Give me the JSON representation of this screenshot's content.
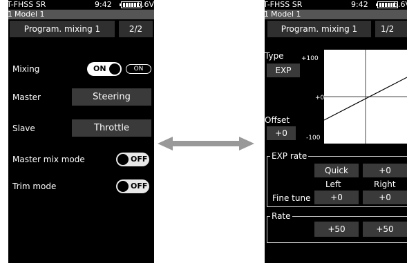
{
  "left": {
    "status": {
      "system": "T-FHSS SR",
      "time": "9:42",
      "voltage": "6.6V"
    },
    "model": {
      "number": "1",
      "name": "Model 1"
    },
    "title": "Program. mixing 1",
    "page": "2/2",
    "mixing": {
      "label": "Mixing",
      "switch_value": "ON",
      "status_value": "ON"
    },
    "master": {
      "label": "Master",
      "value": "Steering"
    },
    "slave": {
      "label": "Slave",
      "value": "Throttle"
    },
    "master_mix_mode": {
      "label": "Master mix mode",
      "value": "OFF"
    },
    "trim_mode": {
      "label": "Trim mode",
      "value": "OFF"
    }
  },
  "right": {
    "status": {
      "system": "T-FHSS SR",
      "time": "9:42",
      "voltage": "6.6V"
    },
    "model": {
      "number": "1",
      "name": "Model 1"
    },
    "title": "Program. mixing 1",
    "page": "1/2",
    "type": {
      "label": "Type",
      "value": "EXP"
    },
    "graph": {
      "top_label": "+100",
      "mid_label": "+0",
      "bottom_label": "-100"
    },
    "offset": {
      "label": "Offset",
      "value": "+0"
    },
    "exp_rate": {
      "title": "EXP rate",
      "quick_label": "Quick",
      "quick_value": "+0",
      "left_header": "Left",
      "right_header": "Right",
      "fine_tune_label": "Fine tune",
      "left_value": "+0",
      "right_value": "+0"
    },
    "rate": {
      "title": "Rate",
      "left_value": "+50",
      "right_value": "+50"
    }
  },
  "colors": {
    "screen_bg": "#000000",
    "model_bar": "#555555",
    "field_bg": "#3a3a3a",
    "arrow": "#999999"
  }
}
